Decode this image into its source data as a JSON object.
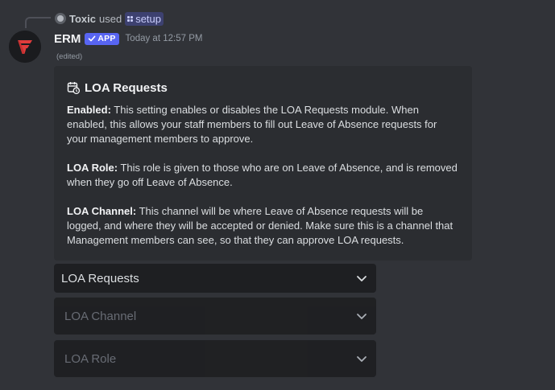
{
  "interaction": {
    "user_name": "Toxic",
    "verb": "used",
    "command": "setup"
  },
  "message": {
    "author": "ERM",
    "badge": "APP",
    "timestamp": "Today at 12:57 PM",
    "edited_label": "(edited)"
  },
  "embed": {
    "title": "LOA Requests",
    "sections": [
      {
        "label": "Enabled:",
        "text": " This setting enables or disables the LOA Requests module. When enabled, this allows your staff members to fill out Leave of Absence requests for your management members to approve."
      },
      {
        "label": "LOA Role:",
        "text": " This role is given to those who are on Leave of Absence, and is removed when they go off Leave of Absence."
      },
      {
        "label": "LOA Channel:",
        "text": " This channel will be where Leave of Absence requests will be logged, and where they will be accepted or denied. Make sure this is a channel that Management members can see, so that they can approve LOA requests."
      }
    ]
  },
  "selects": [
    {
      "label": "LOA Requests",
      "state": "active"
    },
    {
      "label": "LOA Channel",
      "state": "placeholder"
    },
    {
      "label": "LOA Role",
      "state": "placeholder"
    }
  ],
  "colors": {
    "background": "#313338",
    "embed_background": "#2b2d31",
    "select_background": "#1e1f22",
    "app_badge": "#5865f2",
    "brand_red": "#e03c3c"
  },
  "icons": {
    "avatar": "erm-logo-icon",
    "embed_title": "calendar-clock-icon",
    "select_chevron": "chevron-down-icon",
    "command": "slash-command-icon",
    "badge": "checkmark-icon"
  }
}
